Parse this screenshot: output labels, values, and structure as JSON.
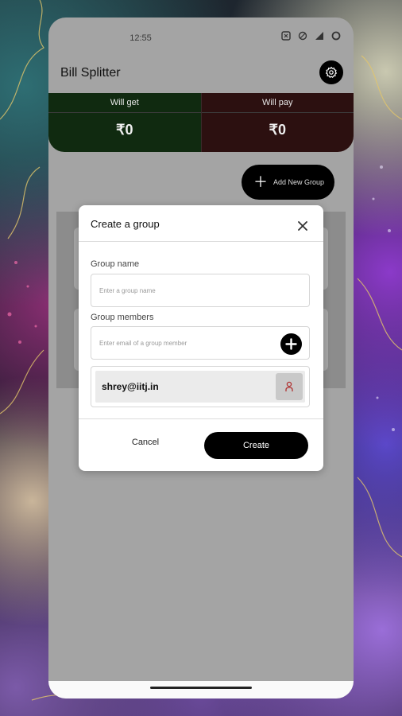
{
  "status_bar": {
    "time": "12:55"
  },
  "app": {
    "title": "Bill Splitter"
  },
  "summary": {
    "get_label": "Will get",
    "get_amount": "₹0",
    "pay_label": "Will pay",
    "pay_amount": "₹0"
  },
  "add_group": {
    "label": "Add New Group"
  },
  "dialog": {
    "title": "Create a group",
    "group_name_label": "Group name",
    "group_name_placeholder": "Enter a group name",
    "members_label": "Group members",
    "member_placeholder": "Enter email of a group member",
    "members": [
      {
        "email": "shrey@iitj.in"
      }
    ],
    "cancel_label": "Cancel",
    "create_label": "Create"
  },
  "icons": {
    "settings": "gear-icon",
    "add": "plus-icon",
    "close": "close-icon",
    "remove_member": "person-icon"
  },
  "colors": {
    "will_get_bg": "#102a10",
    "will_pay_bg": "#2c1010",
    "remove_member_icon": "#b03030"
  }
}
